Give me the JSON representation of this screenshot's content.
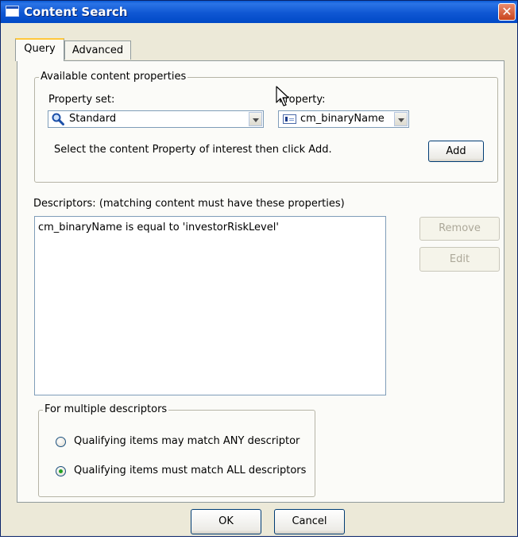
{
  "window": {
    "title": "Content Search",
    "close_symbol": "✕"
  },
  "tabs": [
    {
      "label": "Query",
      "active": true
    },
    {
      "label": "Advanced",
      "active": false
    }
  ],
  "available": {
    "legend": "Available content properties",
    "property_set_label": "Property set:",
    "property_set_value": "Standard",
    "property_label": "Property:",
    "property_value": "cm_binaryName",
    "instruction": "Select the content Property of interest then click Add.",
    "add_label": "Add"
  },
  "descriptors": {
    "label": "Descriptors:  (matching content must have these properties)",
    "items": [
      "cm_binaryName is equal to 'investorRiskLevel'"
    ],
    "remove_label": "Remove",
    "edit_label": "Edit"
  },
  "multiple": {
    "legend": "For multiple descriptors",
    "options": [
      {
        "label": "Qualifying items may match ANY descriptor",
        "selected": false
      },
      {
        "label": "Qualifying items must match ALL descriptors",
        "selected": true
      }
    ]
  },
  "footer": {
    "ok_label": "OK",
    "cancel_label": "Cancel"
  },
  "colors": {
    "titlebar": "#0a5ad6",
    "dialog_bg": "#ece9d8",
    "radio_dot": "#21a121",
    "close_button": "#c9441d"
  }
}
